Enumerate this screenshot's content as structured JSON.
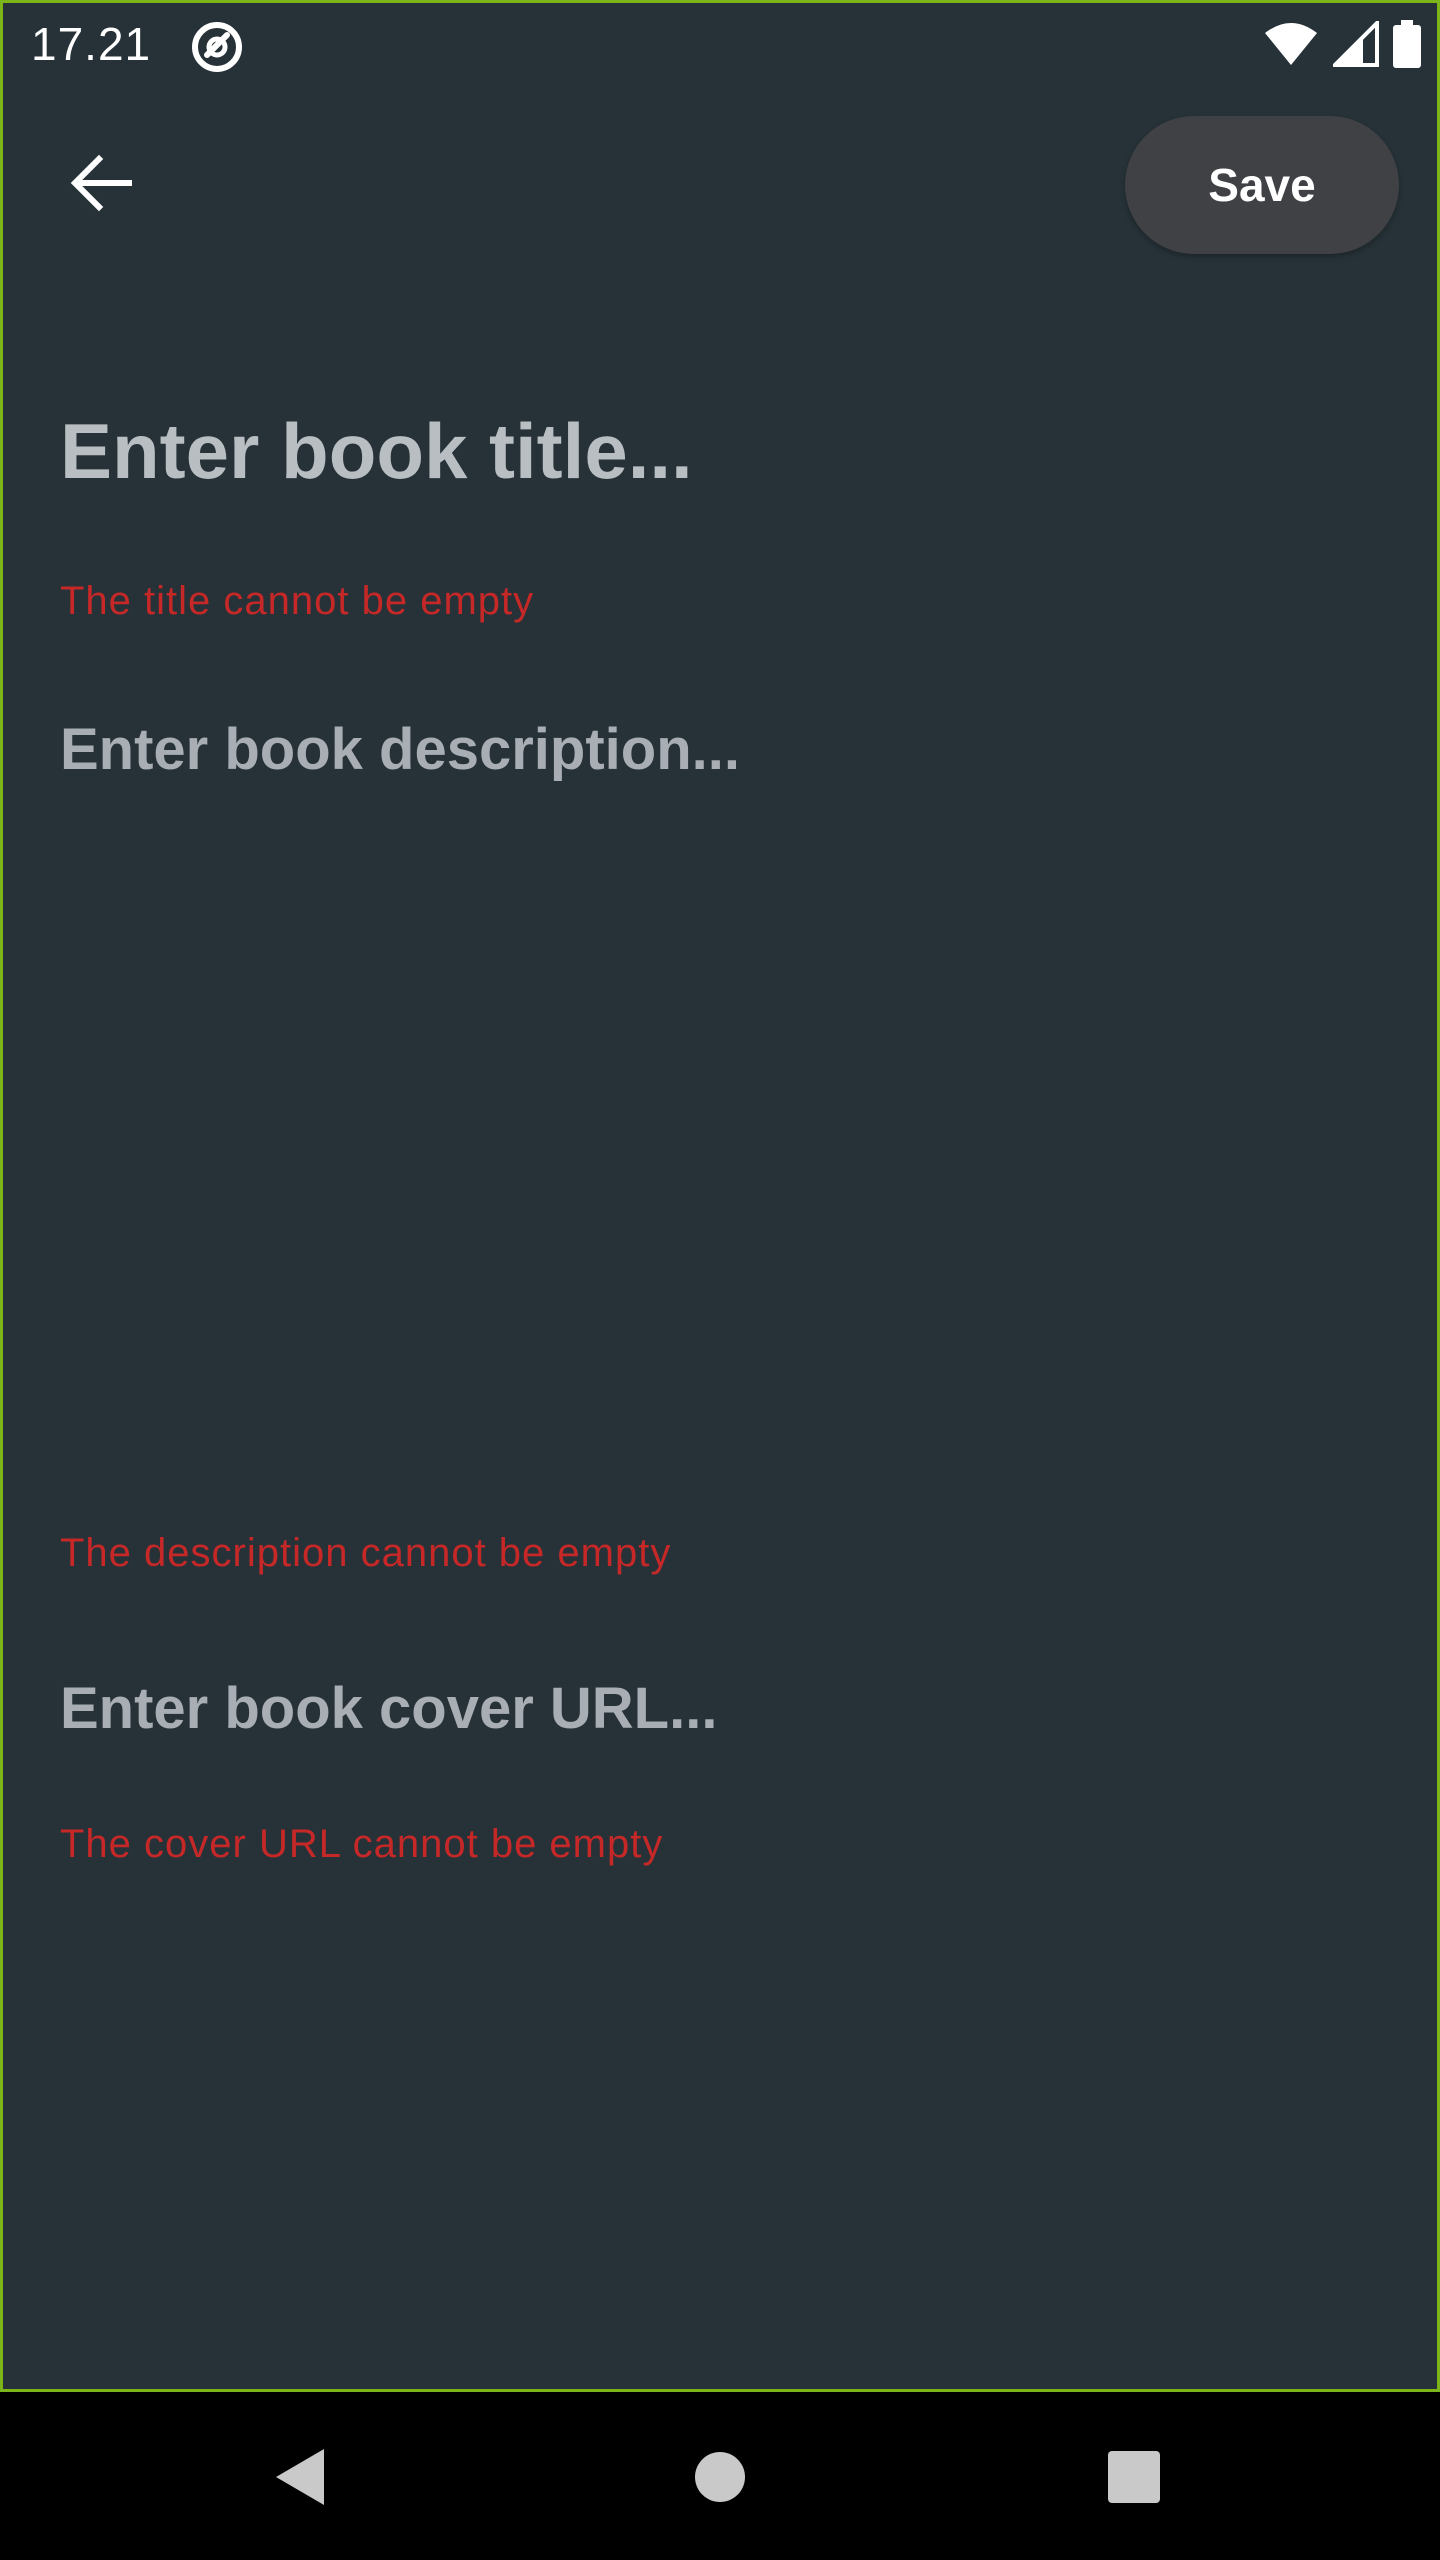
{
  "status_bar": {
    "time": "17.21",
    "icons": [
      "app-notification-icon",
      "wifi-icon",
      "cellular-signal-icon",
      "battery-icon"
    ]
  },
  "toolbar": {
    "back_icon": "arrow-back-icon",
    "save_label": "Save"
  },
  "form": {
    "title": {
      "value": "",
      "placeholder": "Enter book title...",
      "error": "The title cannot be empty"
    },
    "description": {
      "value": "",
      "placeholder": "Enter book description...",
      "error": "The description cannot be empty"
    },
    "cover_url": {
      "value": "",
      "placeholder": "Enter book cover URL...",
      "error": "The cover URL cannot be empty"
    }
  },
  "navigation_bar": {
    "icons": [
      "nav-back-icon",
      "nav-home-icon",
      "nav-recents-icon"
    ]
  },
  "colors": {
    "background": "#263238",
    "error": "#c62828",
    "save_button": "#3f4145",
    "frame_border": "#7cb518"
  }
}
